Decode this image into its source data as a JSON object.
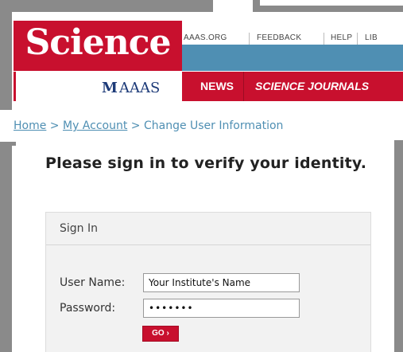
{
  "logo": {
    "text": "Science"
  },
  "publisher": {
    "mark": "M",
    "name": "AAAS"
  },
  "utility_nav": [
    "AAAS.ORG",
    "FEEDBACK",
    "HELP",
    "LIB"
  ],
  "main_nav": [
    "NEWS",
    "SCIENCE JOURNALS"
  ],
  "breadcrumb": {
    "home": "Home",
    "sep1": ">",
    "account": "My Account",
    "sep2": ">",
    "current": "Change User Information"
  },
  "heading": "Please sign in to verify your identity.",
  "signin": {
    "title": "Sign In",
    "username_label": "User Name:",
    "username_value": "Your Institute's Name",
    "password_label": "Password:",
    "password_value": "•••••••",
    "go_label": "GO ›"
  },
  "colors": {
    "brand_red": "#c8102e",
    "brand_blue": "#4f8fb3",
    "frame_gray": "#8a8a8a"
  }
}
